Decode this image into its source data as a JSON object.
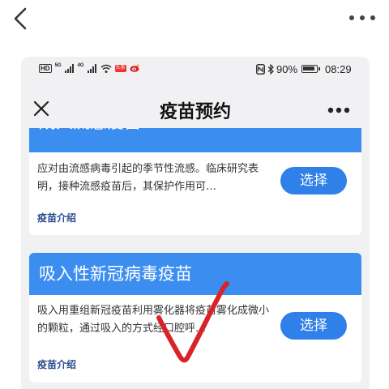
{
  "outer": {
    "back_icon": "chevron-left-icon",
    "more_icon": "more-horizontal-icon"
  },
  "statusbar": {
    "hd": "HD",
    "net1": "5G",
    "net2": "4G",
    "app_badge": "头条",
    "battery": "90%",
    "time": "08:29"
  },
  "nav": {
    "title": "疫苗预约",
    "close_icon": "close-icon",
    "more_icon": "more-horizontal-icon"
  },
  "cards": [
    {
      "title": "成人流感疫苗",
      "desc": "应对由流感病毒引起的季节性流感。临床研究表明，接种流感疫苗后，其保护作用可…",
      "link": "疫苗介绍",
      "button": "选择"
    },
    {
      "title": "吸入性新冠病毒疫苗",
      "desc": "吸入用重组新冠疫苗利用雾化器将疫苗雾化成微小的颗粒，通过吸入的方式经口腔呼…",
      "link": "疫苗介绍",
      "button": "选择"
    }
  ],
  "colors": {
    "card_header": "#3b8ef0",
    "button": "#2f80e8",
    "link": "#2a4c8c",
    "checkmark": "#d8232a"
  }
}
